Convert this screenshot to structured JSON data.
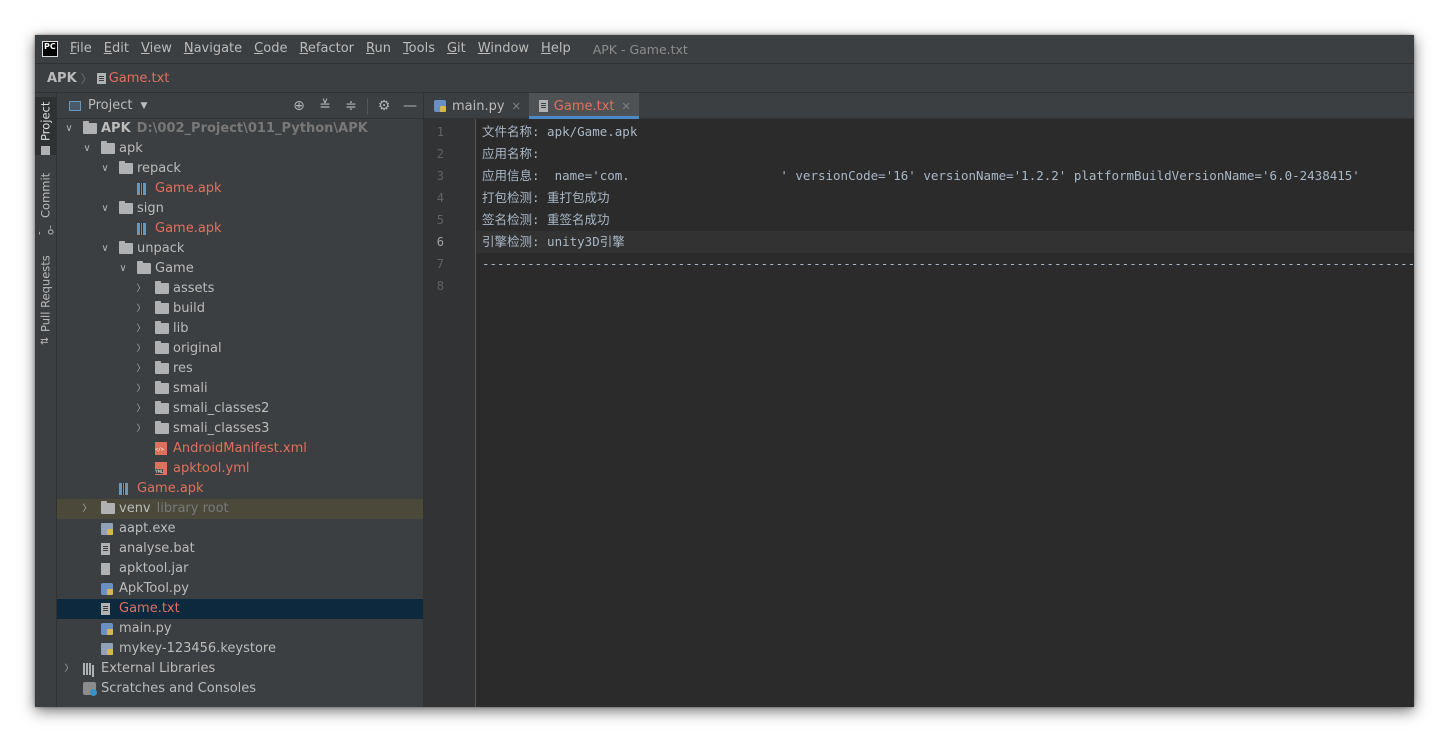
{
  "app": {
    "logo_text": "PC",
    "window_title": "APK - Game.txt"
  },
  "menu": [
    {
      "mn": "F",
      "rest": "ile"
    },
    {
      "mn": "E",
      "rest": "dit"
    },
    {
      "mn": "V",
      "rest": "iew"
    },
    {
      "mn": "N",
      "rest": "avigate"
    },
    {
      "mn": "C",
      "rest": "ode"
    },
    {
      "mn": "R",
      "rest": "efactor"
    },
    {
      "mn": "R",
      "rest": "un"
    },
    {
      "mn": "T",
      "rest": "ools"
    },
    {
      "mn": "G",
      "rest": "it"
    },
    {
      "mn": "W",
      "rest": "indow"
    },
    {
      "mn": "H",
      "rest": "elp"
    }
  ],
  "breadcrumb": {
    "root": "APK",
    "file": "Game.txt"
  },
  "side_strip": {
    "project": "Project",
    "commit": "Commit",
    "pull_requests": "Pull Requests"
  },
  "project_panel": {
    "title": "Project",
    "tools": [
      "crosshair-icon",
      "expand-all-icon",
      "collapse-all-icon",
      "gear-icon",
      "minimize-icon"
    ]
  },
  "tree": [
    {
      "depth": 0,
      "arrow": "down",
      "icon": "folder",
      "label": "APK",
      "bold": true,
      "extra": "D:\\002_Project\\011_Python\\APK"
    },
    {
      "depth": 1,
      "arrow": "down",
      "icon": "folder",
      "label": "apk"
    },
    {
      "depth": 2,
      "arrow": "down",
      "icon": "folder",
      "label": "repack"
    },
    {
      "depth": 3,
      "arrow": "none",
      "icon": "apk",
      "label": "Game.apk",
      "color": "red"
    },
    {
      "depth": 2,
      "arrow": "down",
      "icon": "folder",
      "label": "sign"
    },
    {
      "depth": 3,
      "arrow": "none",
      "icon": "apk",
      "label": "Game.apk",
      "color": "red"
    },
    {
      "depth": 2,
      "arrow": "down",
      "icon": "folder",
      "label": "unpack"
    },
    {
      "depth": 3,
      "arrow": "down",
      "icon": "folder",
      "label": "Game"
    },
    {
      "depth": 4,
      "arrow": "right",
      "icon": "folder",
      "label": "assets"
    },
    {
      "depth": 4,
      "arrow": "right",
      "icon": "folder",
      "label": "build"
    },
    {
      "depth": 4,
      "arrow": "right",
      "icon": "folder",
      "label": "lib"
    },
    {
      "depth": 4,
      "arrow": "right",
      "icon": "folder",
      "label": "original"
    },
    {
      "depth": 4,
      "arrow": "right",
      "icon": "folder",
      "label": "res"
    },
    {
      "depth": 4,
      "arrow": "right",
      "icon": "folder",
      "label": "smali"
    },
    {
      "depth": 4,
      "arrow": "right",
      "icon": "folder",
      "label": "smali_classes2"
    },
    {
      "depth": 4,
      "arrow": "right",
      "icon": "folder",
      "label": "smali_classes3"
    },
    {
      "depth": 4,
      "arrow": "none",
      "icon": "xml",
      "label": "AndroidManifest.xml",
      "color": "red"
    },
    {
      "depth": 4,
      "arrow": "none",
      "icon": "yml",
      "label": "apktool.yml",
      "color": "red"
    },
    {
      "depth": 3,
      "arrow": "none",
      "icon": "apk",
      "label": "Game.apk",
      "color": "red",
      "indent_override": 2
    },
    {
      "depth": 1,
      "arrow": "right",
      "icon": "folder",
      "label": "venv",
      "extra": "library root",
      "highlight": "lib"
    },
    {
      "depth": 1,
      "arrow": "none",
      "icon": "exe",
      "label": "aapt.exe"
    },
    {
      "depth": 1,
      "arrow": "none",
      "icon": "txt",
      "label": "analyse.bat"
    },
    {
      "depth": 1,
      "arrow": "none",
      "icon": "jar",
      "label": "apktool.jar"
    },
    {
      "depth": 1,
      "arrow": "none",
      "icon": "py",
      "label": "ApkTool.py"
    },
    {
      "depth": 1,
      "arrow": "none",
      "icon": "txt",
      "label": "Game.txt",
      "color": "red",
      "highlight": "selected"
    },
    {
      "depth": 1,
      "arrow": "none",
      "icon": "py",
      "label": "main.py"
    },
    {
      "depth": 1,
      "arrow": "none",
      "icon": "exe",
      "label": "mykey-123456.keystore"
    },
    {
      "depth": 0,
      "arrow": "right",
      "icon": "lib",
      "label": "External Libraries"
    },
    {
      "depth": 0,
      "arrow": "none",
      "icon": "scratch",
      "label": "Scratches and Consoles"
    }
  ],
  "editor": {
    "tabs": [
      {
        "label": "main.py",
        "icon": "py",
        "active": false
      },
      {
        "label": "Game.txt",
        "icon": "txt",
        "active": true
      }
    ],
    "current_line": 6,
    "lines": [
      {
        "n": "1",
        "text": "文件名称: apk/Game.apk"
      },
      {
        "n": "2",
        "text": "应用名称:"
      },
      {
        "n": "3",
        "text": "应用信息:  name='com.                    ' versionCode='16' versionName='1.2.2' platformBuildVersionName='6.0-2438415'"
      },
      {
        "n": "4",
        "text": "打包检测: 重打包成功"
      },
      {
        "n": "5",
        "text": "签名检测: 重签名成功"
      },
      {
        "n": "6",
        "text": "引擎检测: unity3D引擎"
      },
      {
        "n": "7",
        "text": "----------------------------------------------------------------------------------------------------------------------------------"
      },
      {
        "n": "8",
        "text": ""
      }
    ]
  },
  "colors": {
    "background": "#2b2b2b",
    "panel": "#3c3f41",
    "accent": "#4a88c7",
    "modified_file": "#e0705d",
    "selection": "#0d293e"
  }
}
